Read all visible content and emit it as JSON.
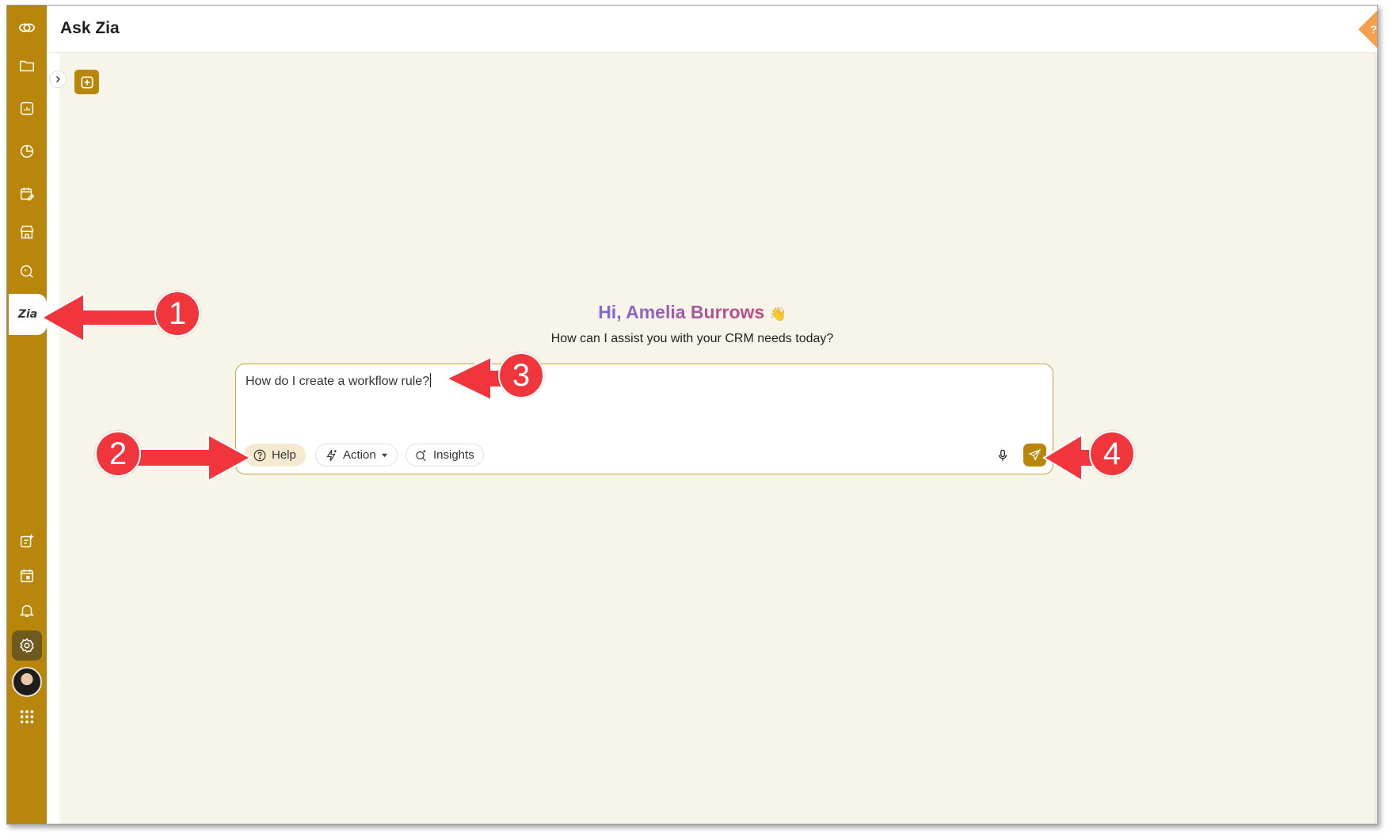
{
  "header": {
    "title": "Ask Zia"
  },
  "sidebar": {
    "items": [
      {
        "icon": "zoho-logo-icon"
      },
      {
        "icon": "folder-icon"
      },
      {
        "icon": "reports-icon"
      },
      {
        "icon": "analytics-icon"
      },
      {
        "icon": "calendar-edit-icon"
      },
      {
        "icon": "store-icon"
      },
      {
        "icon": "search-icon"
      },
      {
        "icon": "zia-icon",
        "label": "Zia",
        "active": true
      },
      {
        "icon": "new-note-icon"
      },
      {
        "icon": "calendar-icon"
      },
      {
        "icon": "bell-icon"
      },
      {
        "icon": "gear-icon"
      },
      {
        "icon": "avatar"
      },
      {
        "icon": "apps-grid-icon"
      }
    ]
  },
  "greeting": {
    "text": "Hi, Amelia Burrows",
    "emoji": "👋"
  },
  "subtitle": "How can I assist you with your CRM needs today?",
  "prompt": {
    "value": "How do I create a workflow rule?",
    "chips": [
      {
        "label": "Help",
        "icon": "question-circle-icon",
        "selected": true
      },
      {
        "label": "Action",
        "icon": "sparkle-bolt-icon",
        "dropdown": true
      },
      {
        "label": "Insights",
        "icon": "search-sparkle-icon"
      }
    ]
  },
  "callouts": [
    "1",
    "2",
    "3",
    "4"
  ],
  "colors": {
    "accent": "#b8860b",
    "background": "#f7f4ea",
    "callout": "#f0363c",
    "greeting_start": "#7b6bd6",
    "greeting_end": "#c24a7a"
  }
}
